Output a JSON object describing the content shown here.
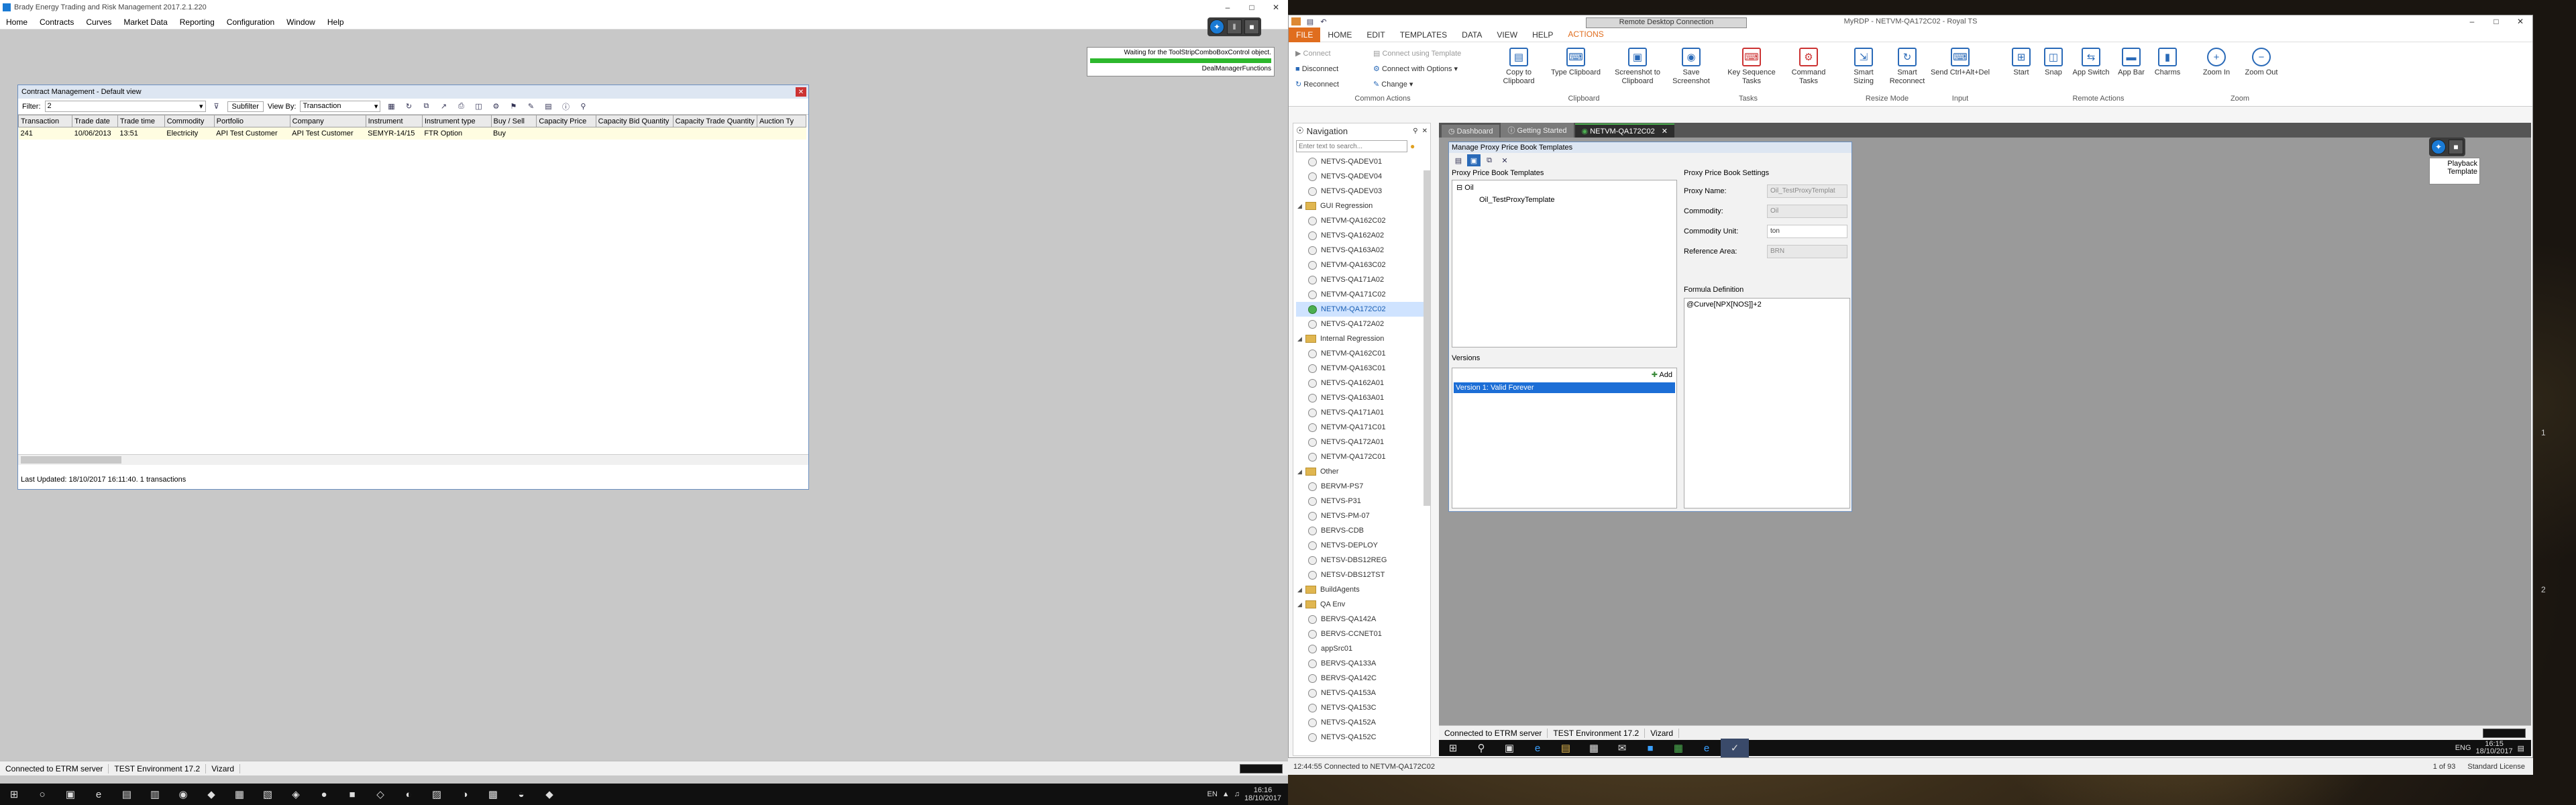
{
  "left": {
    "app_title": "Brady Energy Trading and Risk Management 2017.2.1.220",
    "menu": [
      "Home",
      "Contracts",
      "Curves",
      "Market Data",
      "Reporting",
      "Configuration",
      "Window",
      "Help"
    ],
    "float_btns": [
      "✦",
      "‖",
      "■"
    ],
    "notice": {
      "line1": "Waiting for the ToolStripComboBoxControl object.",
      "line2": "DealManagerFunctions"
    },
    "contract_window": {
      "title": "Contract Management - Default view",
      "filter_label": "Filter:",
      "filter_value": "2",
      "subfilter_label": "Subfilter",
      "viewby_label": "View By:",
      "viewby_value": "Transaction",
      "columns": [
        "Transaction",
        "Trade date",
        "Trade time",
        "Commodity",
        "Portfolio",
        "Company",
        "Instrument",
        "Instrument type",
        "Buy / Sell",
        "Capacity Price",
        "Capacity Bid Quantity",
        "Capacity Trade Quantity",
        "Auction Ty"
      ],
      "rows": [
        [
          "241",
          "10/06/2013",
          "13:51",
          "Electricity",
          "API Test Customer",
          "API Test Customer",
          "SEMYR-14/15",
          "FTR Option",
          "Buy",
          "",
          "",
          "",
          ""
        ]
      ],
      "footer": "Last Updated: 18/10/2017 16:11:40. 1 transactions"
    },
    "status": [
      "Connected to ETRM server",
      "TEST Environment 17.2",
      "Vizard"
    ],
    "taskbar_icons": [
      "⊞",
      "○",
      "▣",
      "e",
      "▤",
      "▥",
      "◉",
      "◆",
      "▦",
      "▧",
      "◈",
      "●",
      "■",
      "◇",
      "◐",
      "▨",
      "◑",
      "▩",
      "◒",
      "◆"
    ],
    "tray": {
      "lang": "EN",
      "time": "16:16",
      "date": "18/10/2017"
    }
  },
  "right": {
    "rdc_title": "Remote Desktop Connection",
    "outer_title": "MyRDP - NETVM-QA172C02 - Royal TS",
    "ribbon_tabs": [
      "FILE",
      "HOME",
      "EDIT",
      "TEMPLATES",
      "DATA",
      "VIEW",
      "HELP",
      "ACTIONS"
    ],
    "ribbon_groups": {
      "common": {
        "label": "Common Actions",
        "items": [
          "Connect",
          "Disconnect",
          "Reconnect",
          "Connect using Template",
          "Connect with Options",
          "Change"
        ]
      },
      "clipboard": {
        "label": "Clipboard",
        "items": [
          "Copy to Clipboard",
          "Type Clipboard",
          "Screenshot to Clipboard"
        ]
      },
      "tasks": {
        "label": "Tasks",
        "items": [
          "Save Screenshot",
          "Key Sequence Tasks",
          "Command Tasks"
        ]
      },
      "resize": {
        "label": "Resize Mode",
        "items": [
          "Smart Sizing",
          "Smart Reconnect"
        ]
      },
      "input": {
        "label": "Input",
        "items": [
          "Send Ctrl+Alt+Del"
        ]
      },
      "remote": {
        "label": "Remote Actions",
        "items": [
          "Start",
          "Snap",
          "App Switch",
          "App Bar",
          "Charms"
        ]
      },
      "zoom": {
        "label": "Zoom",
        "items": [
          "Zoom In",
          "Zoom Out"
        ]
      }
    },
    "nav_title": "Navigation",
    "search_placeholder": "Enter text to search...",
    "nav_items": [
      {
        "type": "item",
        "label": "NETVS-QADEV01"
      },
      {
        "type": "item",
        "label": "NETVS-QADEV04"
      },
      {
        "type": "item",
        "label": "NETVS-QADEV03"
      },
      {
        "type": "folder",
        "label": "GUI Regression"
      },
      {
        "type": "item",
        "label": "NETVM-QA162C02"
      },
      {
        "type": "item",
        "label": "NETVS-QA162A02"
      },
      {
        "type": "item",
        "label": "NETVS-QA163A02"
      },
      {
        "type": "item",
        "label": "NETVM-QA163C02"
      },
      {
        "type": "item",
        "label": "NETVS-QA171A02"
      },
      {
        "type": "item",
        "label": "NETVM-QA171C02"
      },
      {
        "type": "item",
        "label": "NETVM-QA172C02",
        "active": true
      },
      {
        "type": "item",
        "label": "NETVS-QA172A02"
      },
      {
        "type": "folder",
        "label": "Internal Regression"
      },
      {
        "type": "item",
        "label": "NETVM-QA162C01"
      },
      {
        "type": "item",
        "label": "NETVM-QA163C01"
      },
      {
        "type": "item",
        "label": "NETVS-QA162A01"
      },
      {
        "type": "item",
        "label": "NETVS-QA163A01"
      },
      {
        "type": "item",
        "label": "NETVS-QA171A01"
      },
      {
        "type": "item",
        "label": "NETVM-QA171C01"
      },
      {
        "type": "item",
        "label": "NETVS-QA172A01"
      },
      {
        "type": "item",
        "label": "NETVM-QA172C01"
      },
      {
        "type": "folder",
        "label": "Other"
      },
      {
        "type": "item",
        "label": "BERVM-PS7"
      },
      {
        "type": "item",
        "label": "NETVS-P31"
      },
      {
        "type": "item",
        "label": "NETVS-PM-07"
      },
      {
        "type": "item",
        "label": "BERVS-CDB"
      },
      {
        "type": "item",
        "label": "NETVS-DEPLOY"
      },
      {
        "type": "item",
        "label": "NETSV-DBS12REG"
      },
      {
        "type": "item",
        "label": "NETSV-DBS12TST"
      },
      {
        "type": "folder",
        "label": "BuildAgents"
      },
      {
        "type": "folder",
        "label": "QA Env"
      },
      {
        "type": "item",
        "label": "BERVS-QA142A"
      },
      {
        "type": "item",
        "label": "BERVS-CCNET01"
      },
      {
        "type": "item",
        "label": "appSrc01"
      },
      {
        "type": "item",
        "label": "BERVS-QA133A"
      },
      {
        "type": "item",
        "label": "BERVS-QA142C"
      },
      {
        "type": "item",
        "label": "NETVS-QA153A"
      },
      {
        "type": "item",
        "label": "NETVS-QA153C"
      },
      {
        "type": "item",
        "label": "NETVS-QA152A"
      },
      {
        "type": "item",
        "label": "NETVS-QA152C"
      }
    ],
    "doc_tabs": [
      "Dashboard",
      "Getting Started",
      "NETVM-QA172C02"
    ],
    "dialog": {
      "title": "Manage Proxy Price Book Templates",
      "templates_label": "Proxy Price Book Templates",
      "tree_root": "Oil",
      "tree_child": "Oil_TestProxyTemplate",
      "versions_label": "Versions",
      "add_label": "Add",
      "version_item": "Version 1: Valid Forever",
      "settings_label": "Proxy Price Book Settings",
      "fields": [
        {
          "label": "Proxy Name:",
          "value": "Oil_TestProxyTemplat"
        },
        {
          "label": "Commodity:",
          "value": "Oil"
        },
        {
          "label": "Commodity Unit:",
          "value": "ton"
        },
        {
          "label": "Reference Area:",
          "value": "BRN"
        }
      ],
      "formula_label": "Formula Definition",
      "formula": "@Curve[NPX[NOS]]+2"
    },
    "playback_label": "Playback Template",
    "remote_status": [
      "Connected to ETRM server",
      "TEST Environment 17.2",
      "Vizard"
    ],
    "remote_tray": {
      "lang": "ENG",
      "time": "16:15",
      "date": "18/10/2017"
    },
    "royal_status": {
      "conn": "12:44:55 Connected to NETVM-QA172C02",
      "page": "1 of 93",
      "license": "Standard License"
    },
    "side_marks": [
      "1",
      "2"
    ]
  }
}
